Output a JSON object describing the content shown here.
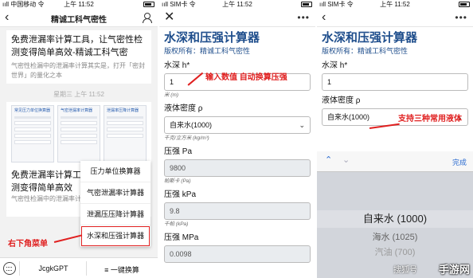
{
  "status": {
    "carrier1": "ııll 中国移动 令",
    "carrier2": "ııll SIM卡 令",
    "carrier3": "ııll SIM卡 令",
    "time": "上午 11:52"
  },
  "panel1": {
    "title": "精诚工科气密性",
    "article1": {
      "title": "免费泄漏率计算工具，让气密性检测变得简单高效-精诚工科气密",
      "desc": "气密性检漏中的泄漏率计算其实是，打开「密封世界」的量化之本"
    },
    "timestamp": "星期三 上午 11:52",
    "thumbs": [
      "常见压力单位换算器",
      "气密泄漏率计算器",
      "泄漏率压降计算器"
    ],
    "article2": {
      "title": "免费泄漏率计算工具，让气密性检测变得简单高效",
      "desc": "气密性检漏中的泄漏率计算其实是"
    },
    "popup_menu": [
      "压力单位换算器",
      "气密泄漏率计算器",
      "泄漏压压降计算器",
      "水深和压强计算器"
    ],
    "annotation": "右下角菜单",
    "bottom": {
      "menu1": "JcgkGPT",
      "menu2": "一键换算"
    }
  },
  "calc": {
    "title": "水深和压强计算器",
    "copyright": "版权所有：精诚工科气密性",
    "depth_label": "水深 h*",
    "depth_value": "1",
    "depth_unit": "米 (m)",
    "density_label": "液体密度 ρ",
    "density_value": "自来水(1000)",
    "density_unit": "千克/立方米 (kg/m³)",
    "pa_label": "压强 Pa",
    "pa_value": "9800",
    "pa_unit": "帕斯卡 (Pa)",
    "kpa_label": "压强 kPa",
    "kpa_value": "9.8",
    "kpa_unit": "千帕 (kPa)",
    "mpa_label": "压强 MPa",
    "mpa_value": "0.0098"
  },
  "annotations": {
    "panel2": "输入数值 自动换算压强",
    "panel3": "支持三种常用液体"
  },
  "picker": {
    "done": "完成",
    "options": [
      "自来水 (1000)",
      "海水 (1025)",
      "汽油 (700)"
    ]
  },
  "watermark": {
    "source": "搜狐号",
    "brand": "手游网"
  }
}
